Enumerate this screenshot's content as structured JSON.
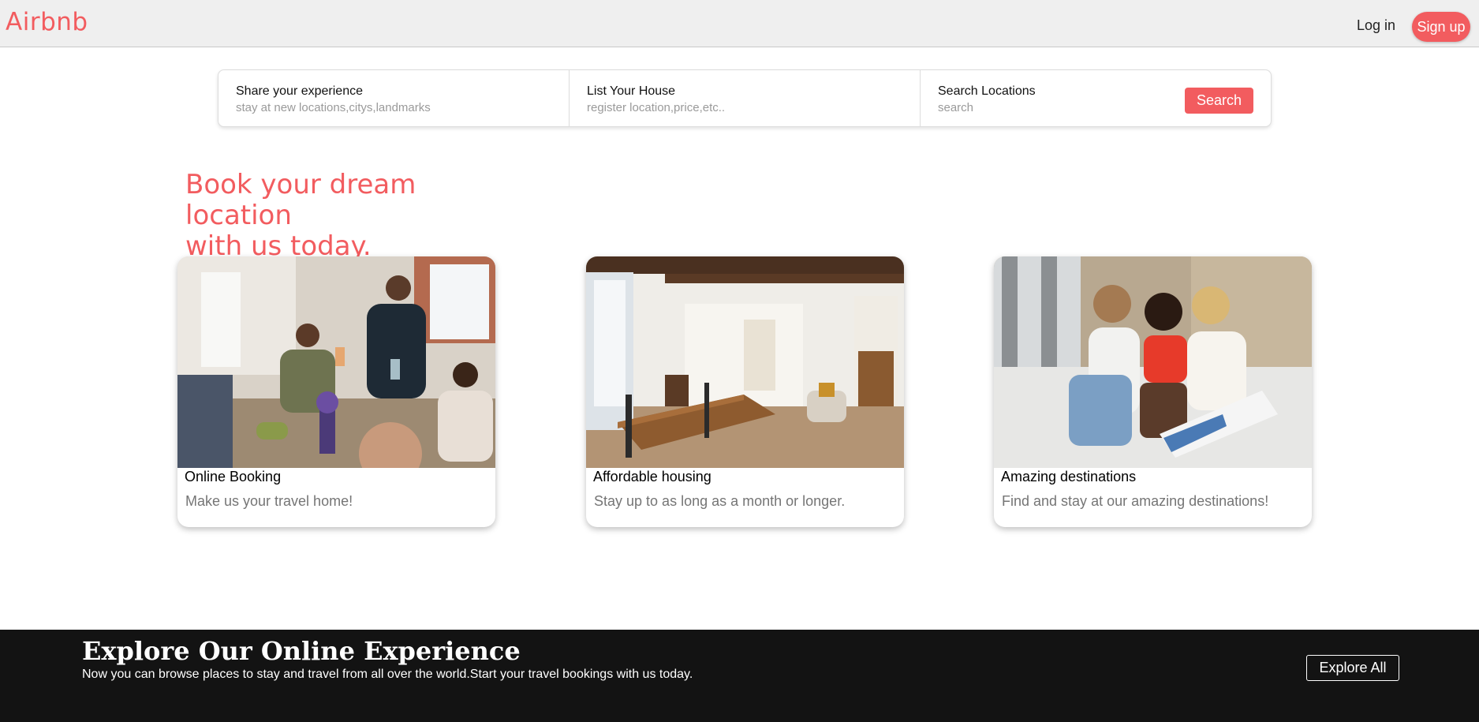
{
  "navbar": {
    "brand": "Airbnb",
    "login_label": "Log in",
    "signup_label": "Sign up",
    "accent_color": "#f25c5f"
  },
  "searchbar": {
    "segments": [
      {
        "title": "Share your experience",
        "subtitle": "stay at new locations,citys,landmarks"
      },
      {
        "title": "List Your House",
        "subtitle": "register location,price,etc.."
      },
      {
        "title": "Search Locations",
        "subtitle": "search"
      }
    ],
    "search_button_label": "Search"
  },
  "hero": {
    "headline_line1": "Book your dream location",
    "headline_line2": "with us today."
  },
  "cards": [
    {
      "title": "Online Booking",
      "description": "Make us your travel home!",
      "image_icon": "dinner-party-photo"
    },
    {
      "title": "Affordable housing",
      "description": "Stay up to as long as a month or longer.",
      "image_icon": "dining-room-photo"
    },
    {
      "title": "Amazing destinations",
      "description": "Find and stay at our amazing destinations!",
      "image_icon": "friends-reading-photo"
    }
  ],
  "footer": {
    "title": "Explore Our Online Experience",
    "subtitle": "Now you can browse places to stay and travel from all over the world.Start your travel bookings with us today.",
    "explore_label": "Explore All",
    "background_color": "#131313"
  }
}
